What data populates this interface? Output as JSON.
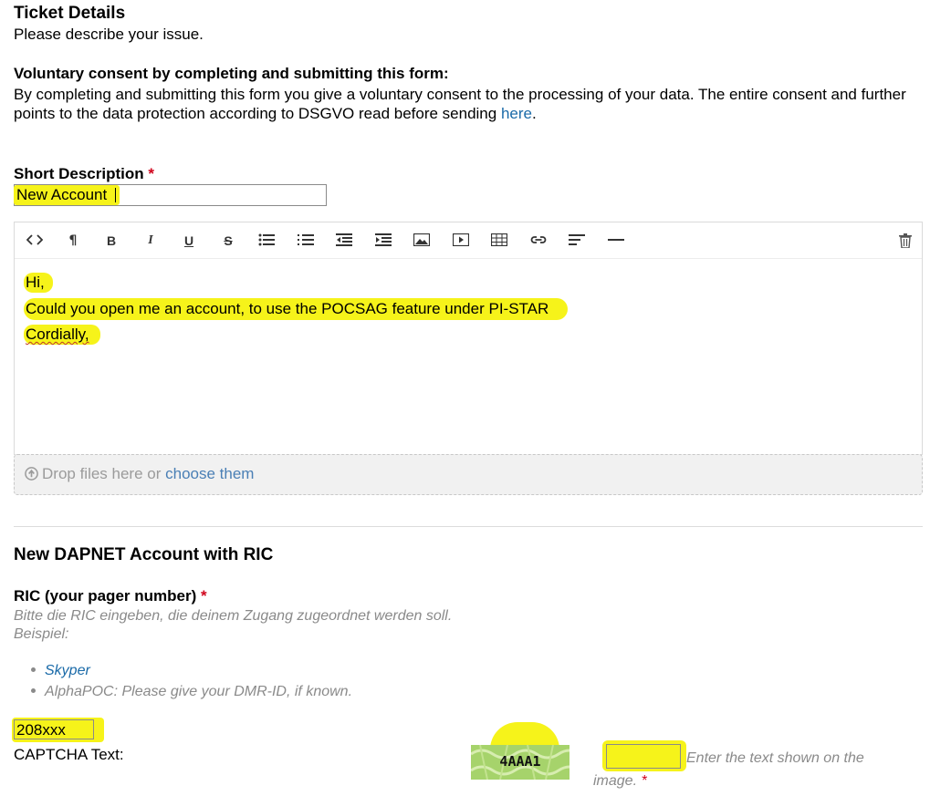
{
  "ticket": {
    "title": "Ticket Details",
    "subtitle": "Please describe your issue."
  },
  "consent": {
    "title": "Voluntary consent by completing and submitting this form:",
    "body": "By completing and submitting this form you give a voluntary consent to the processing of your data. The entire consent and further points to the data protection according to DSGVO read before sending ",
    "link": "here",
    "after_link": "."
  },
  "short_description": {
    "label": "Short Description",
    "required_mark": "*",
    "value": "New Account"
  },
  "editor": {
    "toolbar": [
      {
        "name": "code-view-icon",
        "glyph": "<>"
      },
      {
        "name": "paragraph-icon",
        "glyph": "¶"
      },
      {
        "name": "bold-icon",
        "glyph": "B"
      },
      {
        "name": "italic-icon",
        "glyph": "I"
      },
      {
        "name": "underline-icon",
        "glyph": "U"
      },
      {
        "name": "strikethrough-icon",
        "glyph": "S"
      },
      {
        "name": "unordered-list-icon",
        "glyph": ""
      },
      {
        "name": "ordered-list-icon",
        "glyph": ""
      },
      {
        "name": "outdent-icon",
        "glyph": ""
      },
      {
        "name": "indent-icon",
        "glyph": ""
      },
      {
        "name": "image-icon",
        "glyph": ""
      },
      {
        "name": "video-icon",
        "glyph": ""
      },
      {
        "name": "table-icon",
        "glyph": ""
      },
      {
        "name": "link-icon",
        "glyph": ""
      },
      {
        "name": "align-icon",
        "glyph": ""
      },
      {
        "name": "horizontal-rule-icon",
        "glyph": ""
      },
      {
        "name": "trash-icon",
        "glyph": ""
      }
    ],
    "lines": [
      "Hi,",
      "Could you open me an account, to use the POCSAG feature under PI-STAR",
      "Cordially,"
    ]
  },
  "dropzone": {
    "text": "Drop files here or ",
    "link": "choose them"
  },
  "dapnet": {
    "title": "New DAPNET Account with RIC",
    "ric_label": "RIC (your pager number)",
    "required_mark": "*",
    "hint_line1": "Bitte die RIC eingeben, die deinem Zugang zugeordnet werden soll.",
    "hint_line2": "Beispiel:",
    "bullet_skyper": "Skyper",
    "bullet_alphapoc": "AlphaPOC: Please give your DMR-ID, if known.",
    "ric_value": "208xxx"
  },
  "captcha": {
    "label": "CAPTCHA Text:",
    "code": "4AAA1",
    "hint": "Enter the text shown on the image.",
    "required_mark": "*",
    "input_value": ""
  },
  "colors": {
    "highlight": "#f6f31a",
    "link": "#1a6aa8",
    "required": "#d0021b",
    "hint": "#8a8a8a"
  }
}
